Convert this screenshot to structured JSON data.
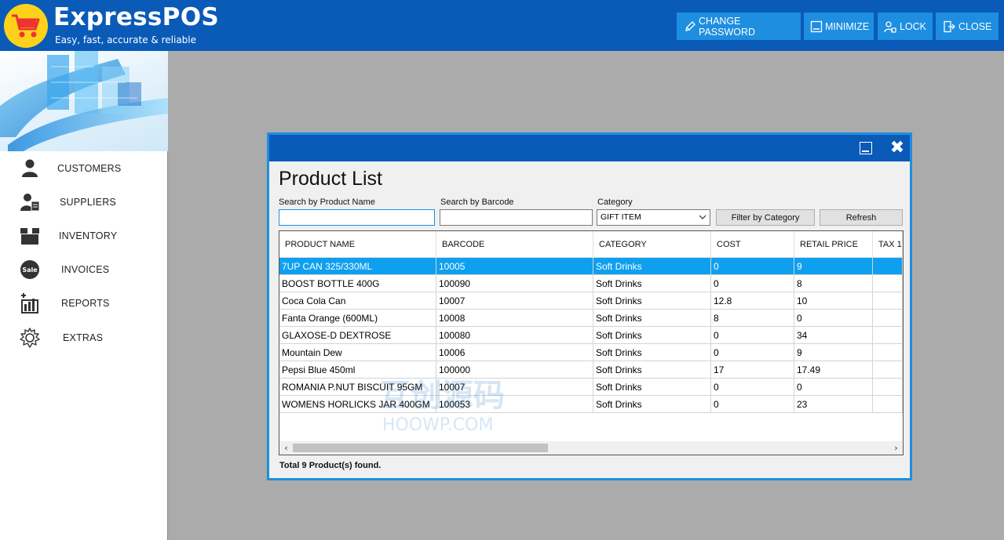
{
  "app": {
    "title": "ExpressPOS",
    "tagline": "Easy, fast, accurate & reliable",
    "colors": {
      "header": "#0a5ab8",
      "button": "#1e8ee0",
      "selected_row": "#0f9fef",
      "logo": "#ffd21a"
    }
  },
  "header": {
    "buttons": [
      {
        "label": "CHANGE PASSWORD",
        "icon": "pen-icon"
      },
      {
        "label": "MINIMIZE",
        "icon": "minimize-icon"
      },
      {
        "label": "LOCK",
        "icon": "user-lock-icon"
      },
      {
        "label": "CLOSE",
        "icon": "exit-door-icon"
      }
    ]
  },
  "sidebar": {
    "items": [
      {
        "label": "CUSTOMERS",
        "icon": "person-icon"
      },
      {
        "label": "SUPPLIERS",
        "icon": "supplier-icon"
      },
      {
        "label": "INVENTORY",
        "icon": "box-icon"
      },
      {
        "label": "INVOICES",
        "icon": "sale-badge-icon"
      },
      {
        "label": "REPORTS",
        "icon": "bar-chart-icon"
      },
      {
        "label": "EXTRAS",
        "icon": "gear-icon"
      }
    ]
  },
  "dialog": {
    "title": "Product List",
    "search_name_label": "Search by Product Name",
    "search_name_value": "",
    "search_barcode_label": "Search by Barcode",
    "search_barcode_value": "",
    "category_label": "Category",
    "category_selected": "GIFT ITEM",
    "filter_button": "Filter by Category",
    "refresh_button": "Refresh",
    "columns": [
      "PRODUCT NAME",
      "BARCODE",
      "CATEGORY",
      "COST",
      "RETAIL PRICE",
      "TAX 1"
    ],
    "rows": [
      [
        "7UP CAN 325/330ML",
        "10005",
        "Soft Drinks",
        "0",
        "9",
        ""
      ],
      [
        "BOOST BOTTLE 400G",
        "100090",
        "Soft Drinks",
        "0",
        "8",
        ""
      ],
      [
        "Coca Cola Can",
        "10007",
        "Soft Drinks",
        "12.8",
        "10",
        ""
      ],
      [
        "Fanta Orange (600ML)",
        "10008",
        "Soft Drinks",
        "8",
        "0",
        ""
      ],
      [
        "GLAXOSE-D DEXTROSE",
        "100080",
        "Soft Drinks",
        "0",
        "34",
        ""
      ],
      [
        "Mountain Dew",
        "10006",
        "Soft Drinks",
        "0",
        "9",
        ""
      ],
      [
        "Pepsi Blue 450ml",
        "100000",
        "Soft Drinks",
        "17",
        "17.49",
        ""
      ],
      [
        "ROMANIA P.NUT BISCUIT 95GM",
        "10007",
        "Soft Drinks",
        "0",
        "0",
        ""
      ],
      [
        "WOMENS HORLICKS JAR 400GM",
        "100053",
        "Soft Drinks",
        "0",
        "23",
        ""
      ]
    ],
    "selected_row": 0,
    "status": "Total 9 Product(s) found."
  },
  "watermark": {
    "line1": "互创源码",
    "line2": "HOOWP.COM"
  }
}
